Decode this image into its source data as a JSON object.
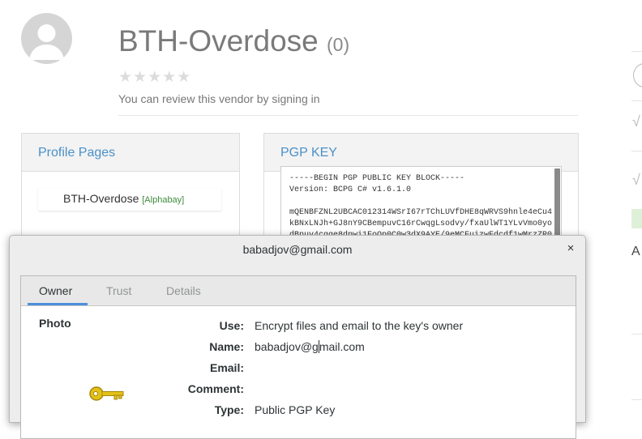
{
  "vendor": {
    "name": "BTH-Overdose",
    "review_count": "(0)",
    "stars": "★★★★★",
    "review_note": "You can review this vendor by signing in"
  },
  "profile_panel": {
    "title": "Profile Pages",
    "item_name": "BTH-Overdose",
    "item_tag": "[Alphabay]"
  },
  "pgp_panel": {
    "title": "PGP KEY",
    "key_text": "-----BEGIN PGP PUBLIC KEY BLOCK-----\nVersion: BCPG C# v1.6.1.0\n\nmQENBFZNL2UBCAC012314WSrI67rTChLUVfDHE8qWRVS9hnle4eCu4\nkBNxLNJh+GJ8nY9CBempuvC16rCwqgLsodvy/fxaUlWT1YLvVmo0yo\ndBpuv4cqqe8dpwi1FoQp0C0w3dX9AYE/9eMCFuizwFdcdf1wMrzZR0"
  },
  "right_edge": {
    "letter": "A",
    "check": "√"
  },
  "dialog": {
    "title": "babadjov@gmail.com",
    "close_glyph": "×",
    "tabs": [
      "Owner",
      "Trust",
      "Details"
    ],
    "photo_label": "Photo",
    "fields": {
      "use_label": "Use:",
      "use_value": "Encrypt files and email to the key's owner",
      "name_label": "Name:",
      "name_value_before_caret": "babadjov@g",
      "name_value_after_caret": "mail.com",
      "email_label": "Email:",
      "email_value": "",
      "comment_label": "Comment:",
      "comment_value": "",
      "type_label": "Type:",
      "type_value": "Public PGP Key"
    },
    "icon": "key-icon"
  },
  "colors": {
    "link_blue": "#4a90c8",
    "tab_accent": "#4a90d9",
    "tag_green": "#3d8b3d",
    "key_gold": "#e3c217"
  }
}
